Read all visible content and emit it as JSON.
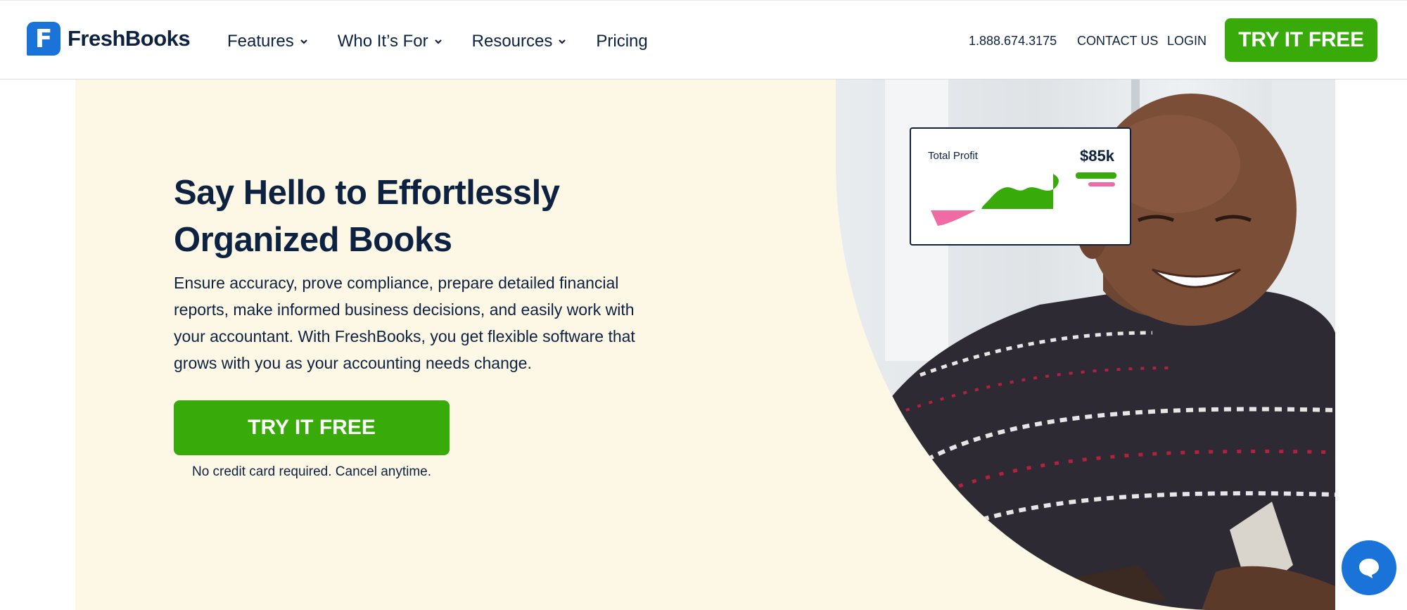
{
  "header": {
    "logo_text": "FreshBooks",
    "logo_mark": "F",
    "nav": [
      {
        "label": "Features",
        "has_dropdown": true
      },
      {
        "label": "Who It’s For",
        "has_dropdown": true
      },
      {
        "label": "Resources",
        "has_dropdown": true
      },
      {
        "label": "Pricing",
        "has_dropdown": false
      }
    ],
    "phone": "1.888.674.3175",
    "contact": "CONTACT US",
    "login": "LOGIN",
    "cta": "TRY IT FREE"
  },
  "hero": {
    "title_line1": "Say Hello to Effortlessly",
    "title_line2": "Organized Books",
    "description": "Ensure accuracy, prove compliance, prepare detailed financial reports, make informed business decisions, and easily work with your accountant. With FreshBooks, you get flexible software that grows with you as your accounting needs change.",
    "cta": "TRY IT FREE",
    "note": "No credit card required. Cancel anytime."
  },
  "profit_card": {
    "label": "Total Profit",
    "value": "$85k"
  },
  "colors": {
    "brand_green": "#38ab0a",
    "brand_blue": "#1a73d9",
    "navy": "#0d2240",
    "hero_bg": "#fdf8e6",
    "pink": "#f06aa4"
  },
  "icons": {
    "chat": "chat-bubble-icon",
    "dropdown": "chevron-down-icon"
  }
}
